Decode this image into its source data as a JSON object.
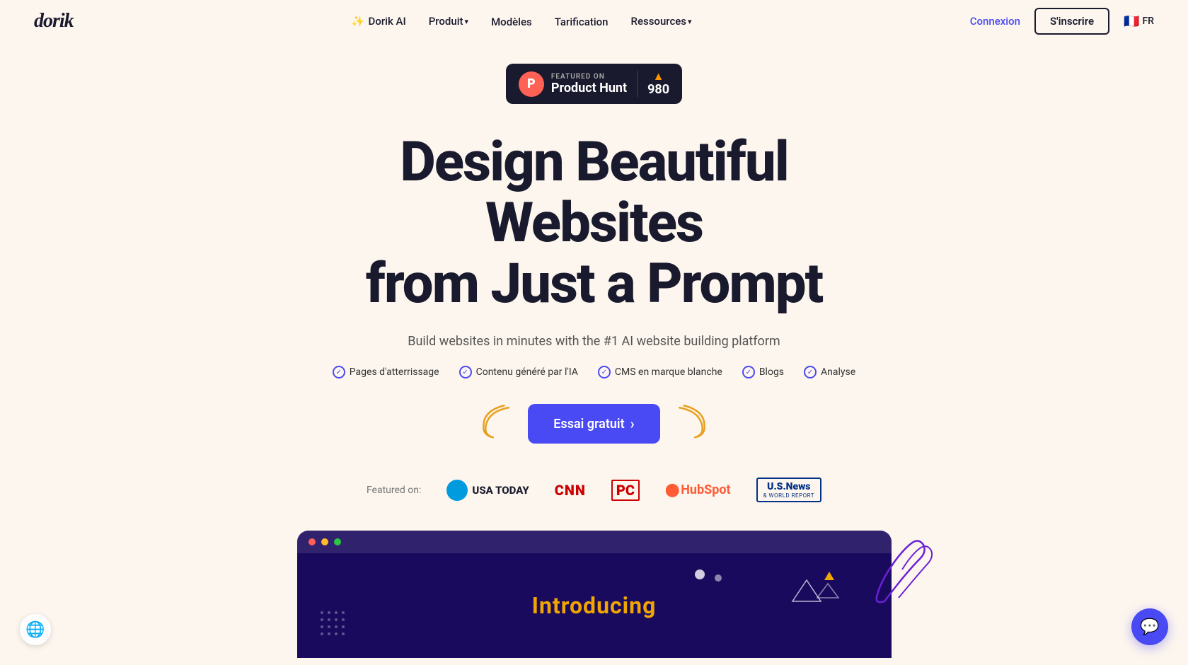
{
  "nav": {
    "logo": "dorik",
    "links": [
      {
        "id": "dorik-ai",
        "label": "Dorik AI",
        "icon": "✨",
        "hasIcon": true
      },
      {
        "id": "produit",
        "label": "Produit",
        "hasDropdown": true
      },
      {
        "id": "modeles",
        "label": "Modèles"
      },
      {
        "id": "tarification",
        "label": "Tarification"
      },
      {
        "id": "ressources",
        "label": "Ressources",
        "hasDropdown": true
      }
    ],
    "connexion": "Connexion",
    "signup": "S'inscrire",
    "lang_flag": "🇫🇷",
    "lang_code": "FR"
  },
  "hero": {
    "ph_badge": {
      "featured_label": "FEATURED ON",
      "name": "Product Hunt",
      "vote_count": "980"
    },
    "title_line1": "Design Beautiful Websites",
    "title_line2": "from Just a Prompt",
    "subtitle": "Build websites in minutes with the #1 AI website building platform",
    "features": [
      "Pages d'atterrissage",
      "Contenu généré par l'IA",
      "CMS en marque blanche",
      "Blogs",
      "Analyse"
    ],
    "cta_button": "Essai gratuit",
    "cta_arrow": "›",
    "featured_on_label": "Featured on:",
    "featured_logos": [
      {
        "id": "usa-today",
        "text": "USA TODAY"
      },
      {
        "id": "cnn",
        "text": "CNN"
      },
      {
        "id": "pc",
        "text": "PC"
      },
      {
        "id": "hubspot",
        "text": "HubSpot"
      },
      {
        "id": "usnews",
        "top": "U.S.News",
        "bottom": "& WORLD REPORT"
      }
    ],
    "demo_intro_text": "Introducing"
  },
  "chat_button_title": "Chat support",
  "privacy_button_title": "Privacy settings"
}
